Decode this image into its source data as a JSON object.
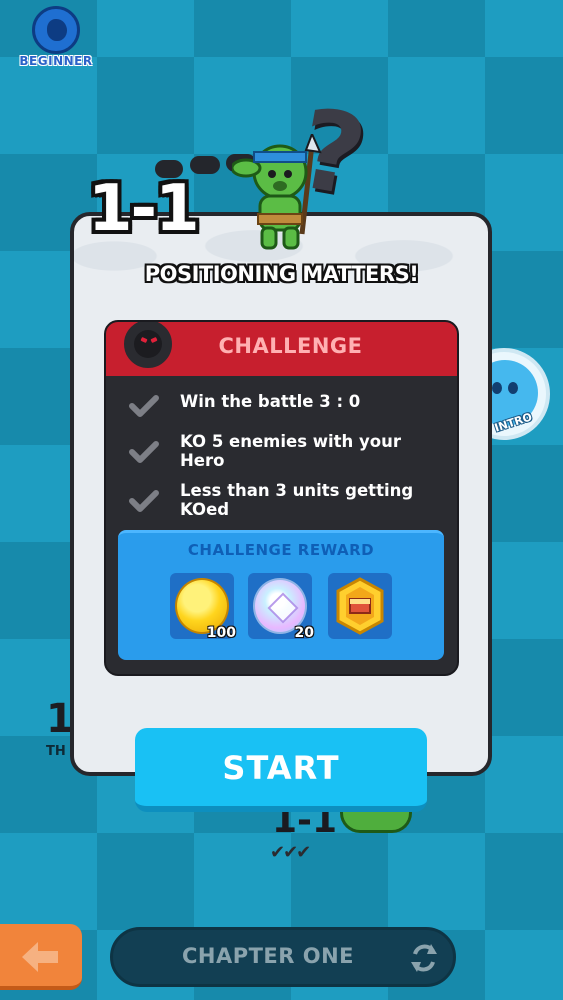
{
  "difficulty": {
    "label": "BEGINNER"
  },
  "intro": {
    "label": "INTRO"
  },
  "level": {
    "number": "1-1",
    "title": "POSITIONING MATTERS!"
  },
  "background_levels": {
    "left_number": "1",
    "left_sub": "TH",
    "center_number": "1-1",
    "center_stars": "✔✔✔"
  },
  "challenge": {
    "title": "CHALLENGE",
    "items": [
      {
        "text": "Win the battle 3 : 0"
      },
      {
        "text": "KO 5 enemies with your Hero"
      },
      {
        "text": "Less than 3 units getting KOed"
      }
    ],
    "reward": {
      "title": "CHALLENGE REWARD",
      "items": [
        {
          "icon": "gold-coin-icon",
          "qty": "100"
        },
        {
          "icon": "gem-icon",
          "qty": "20"
        },
        {
          "icon": "badge-icon",
          "qty": ""
        }
      ]
    }
  },
  "buttons": {
    "start": "START"
  },
  "footer": {
    "chapter": "CHAPTER ONE"
  },
  "colors": {
    "accent": "#19c1f4",
    "challenge_red": "#c71f2e",
    "reward_blue": "#2a9cec",
    "back_orange": "#f1843b"
  }
}
